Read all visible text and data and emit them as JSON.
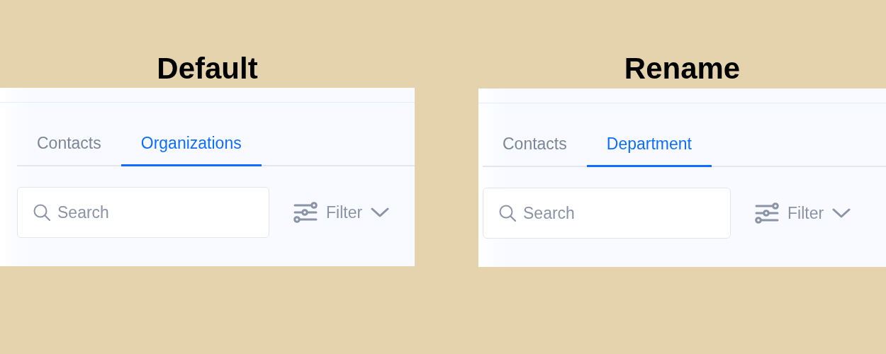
{
  "panels": [
    {
      "heading": "Default",
      "tabs": [
        {
          "label": "Contacts",
          "selected": false
        },
        {
          "label": "Organizations",
          "selected": true
        }
      ],
      "search": {
        "placeholder": "Search"
      },
      "filter": {
        "label": "Filter"
      }
    },
    {
      "heading": "Rename",
      "tabs": [
        {
          "label": "Contacts",
          "selected": false
        },
        {
          "label": "Department",
          "selected": true
        }
      ],
      "search": {
        "placeholder": "Search"
      },
      "filter": {
        "label": "Filter"
      }
    }
  ]
}
